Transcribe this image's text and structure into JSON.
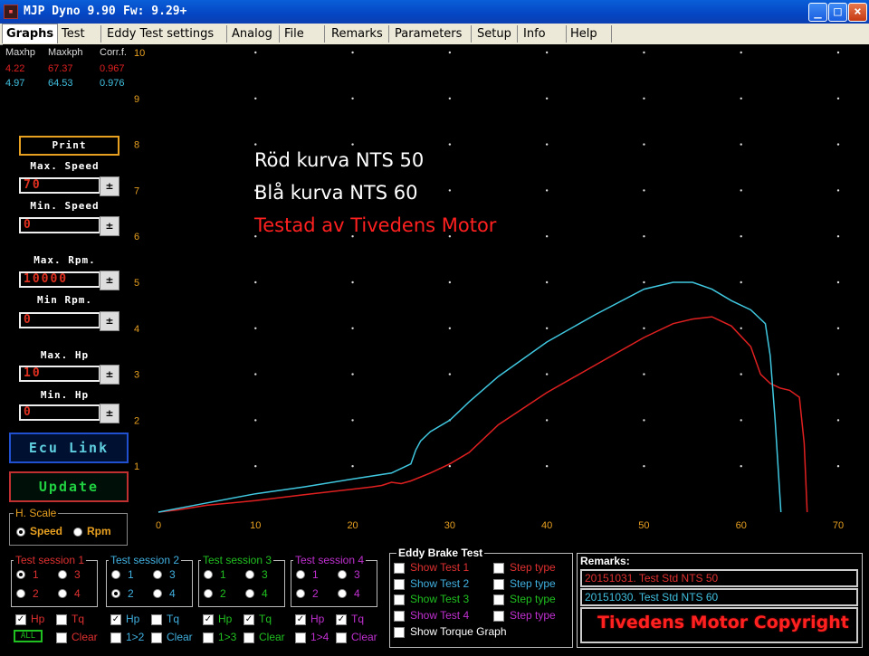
{
  "window": {
    "title": "MJP Dyno 9.90",
    "firmware": "Fw: 9.29+",
    "icon": "app-icon",
    "minimize": "_",
    "maximize": "□",
    "close": "×"
  },
  "menu": [
    "Graphs",
    "Test",
    "Eddy Test settings",
    "Analog",
    "File",
    "Remarks",
    "Parameters",
    "Setup",
    "Info",
    "Help"
  ],
  "stats": {
    "headers": [
      "Maxhp",
      "Maxkph",
      "Corr.f."
    ],
    "rows": [
      {
        "maxhp": "4.22",
        "maxkph": "67.37",
        "corr": "0.967",
        "color": "#e02020"
      },
      {
        "maxhp": "4.97",
        "maxkph": "64.53",
        "corr": "0.976",
        "color": "#40c0e0"
      }
    ]
  },
  "controls": {
    "print": "Print",
    "max_speed_label": "Max. Speed",
    "max_speed": "70",
    "min_speed_label": "Min. Speed",
    "min_speed": "0",
    "max_rpm_label": "Max. Rpm.",
    "max_rpm": "10000",
    "min_rpm_label": "Min Rpm.",
    "min_rpm": "0",
    "max_hp_label": "Max. Hp",
    "max_hp": "10",
    "min_hp_label": "Min. Hp",
    "min_hp": "0",
    "ecu_link": "Ecu Link",
    "update": "Update",
    "hscale_label": "H. Scale",
    "speed": "Speed",
    "rpm": "Rpm"
  },
  "annotations": [
    {
      "text": "Röd kurva NTS 50",
      "color": "#ffffff"
    },
    {
      "text": "Blå kurva  NTS 60",
      "color": "#ffffff"
    },
    {
      "text": "Testad av Tivedens Motor",
      "color": "#ff2020"
    }
  ],
  "chart_data": {
    "type": "line",
    "xlim": [
      0,
      70
    ],
    "ylim": [
      0,
      10
    ],
    "x_ticks": [
      0,
      10,
      20,
      30,
      40,
      50,
      60,
      70
    ],
    "y_ticks": [
      1,
      2,
      3,
      4,
      5,
      6,
      7,
      8,
      9,
      10
    ],
    "grid": true,
    "series": [
      {
        "color": "#e02020",
        "x": [
          0,
          2,
          5,
          10,
          15,
          20,
          22,
          23,
          24,
          25,
          26,
          28,
          30,
          32,
          35,
          40,
          45,
          50,
          53,
          55,
          57,
          59,
          61,
          62,
          63,
          64,
          65,
          66,
          66.5,
          66.8
        ],
        "y": [
          0,
          0.05,
          0.15,
          0.25,
          0.38,
          0.5,
          0.55,
          0.58,
          0.65,
          0.62,
          0.68,
          0.85,
          1.05,
          1.3,
          1.9,
          2.6,
          3.2,
          3.8,
          4.1,
          4.2,
          4.25,
          4.05,
          3.6,
          3.0,
          2.8,
          2.7,
          2.65,
          2.5,
          1.5,
          0
        ]
      },
      {
        "color": "#40c8e0",
        "x": [
          0,
          5,
          10,
          15,
          20,
          24,
          26,
          26.5,
          27,
          28,
          30,
          32,
          35,
          40,
          45,
          50,
          53,
          55,
          57,
          59,
          61,
          62.5,
          63,
          63.5,
          63.8,
          64.1
        ],
        "y": [
          0,
          0.2,
          0.4,
          0.55,
          0.72,
          0.85,
          1.05,
          1.35,
          1.55,
          1.75,
          2.0,
          2.4,
          2.95,
          3.7,
          4.3,
          4.85,
          5.0,
          5.0,
          4.85,
          4.6,
          4.4,
          4.1,
          3.4,
          2.0,
          1.0,
          0
        ]
      }
    ]
  },
  "sessions": [
    {
      "title": "Test session 1",
      "color": "#e03030",
      "opts": [
        "1",
        "3",
        "2",
        "4"
      ],
      "selected": 0,
      "hp": "Hp",
      "tq": "Tq",
      "hp_on": true,
      "tq_on": false,
      "extra": "Clear",
      "extra_btn": "ALL"
    },
    {
      "title": "Test session 2",
      "color": "#40b0e0",
      "opts": [
        "1",
        "3",
        "2",
        "4"
      ],
      "selected": 2,
      "hp": "Hp",
      "tq": "Tq",
      "hp_on": true,
      "tq_on": false,
      "extra": "Clear",
      "cmp": "1>2"
    },
    {
      "title": "Test session 3",
      "color": "#20c020",
      "opts": [
        "1",
        "3",
        "2",
        "4"
      ],
      "selected": -1,
      "hp": "Hp",
      "tq": "Tq",
      "hp_on": true,
      "tq_on": true,
      "extra": "Clear",
      "cmp": "1>3"
    },
    {
      "title": "Test session 4",
      "color": "#c030d0",
      "opts": [
        "1",
        "3",
        "2",
        "4"
      ],
      "selected": -1,
      "hp": "Hp",
      "tq": "Tq",
      "hp_on": true,
      "tq_on": true,
      "extra": "Clear",
      "cmp": "1>4"
    }
  ],
  "eddy": {
    "title": "Eddy Brake Test",
    "tests": [
      {
        "label": "Show Test 1",
        "step": "Step type",
        "color": "#e03030"
      },
      {
        "label": "Show Test 2",
        "step": "Step type",
        "color": "#40b0e0"
      },
      {
        "label": "Show Test 3",
        "step": "Step type",
        "color": "#20c020"
      },
      {
        "label": "Show Test 4",
        "step": "Step type",
        "color": "#c030d0"
      }
    ],
    "torque": "Show Torque Graph"
  },
  "remarks": {
    "title": "Remarks:",
    "lines": [
      {
        "text": "20151031. Test Std NTS 50",
        "color": "#e03030"
      },
      {
        "text": "20151030. Test Std NTS 60",
        "color": "#40c0e0"
      }
    ],
    "watermark": "Tivedens Motor Copyright"
  }
}
